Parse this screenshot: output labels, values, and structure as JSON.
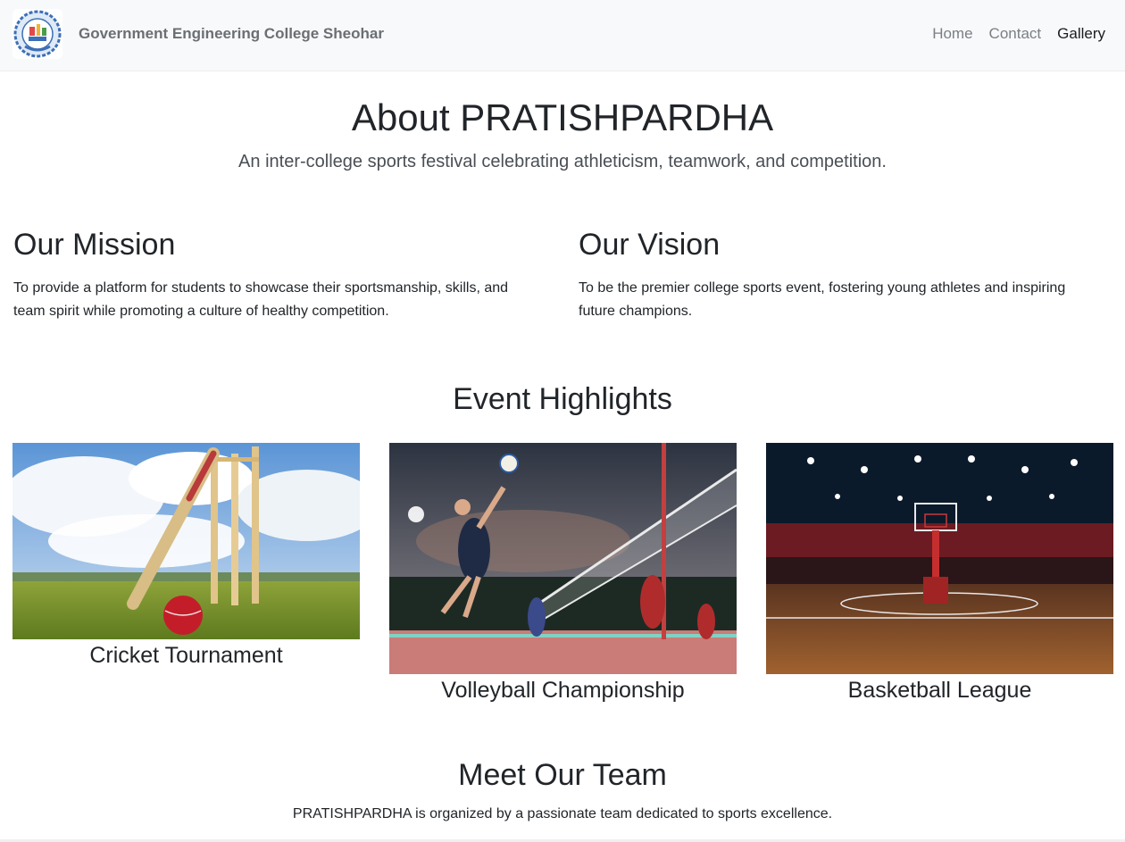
{
  "navbar": {
    "brand": "Government Engineering College Sheohar",
    "logo_icon": "college-emblem-icon",
    "links": [
      {
        "label": "Home",
        "active": false
      },
      {
        "label": "Contact",
        "active": false
      },
      {
        "label": "Gallery",
        "active": true
      }
    ]
  },
  "hero": {
    "title": "About PRATISHPARDHA",
    "subtitle": "An inter-college sports festival celebrating athleticism, teamwork, and competition."
  },
  "mission": {
    "heading": "Our Mission",
    "text": "To provide a platform for students to showcase their sportsmanship, skills, and team spirit while promoting a culture of healthy competition."
  },
  "vision": {
    "heading": "Our Vision",
    "text": "To be the premier college sports event, fostering young athletes and inspiring future champions."
  },
  "highlights": {
    "heading": "Event Highlights",
    "events": [
      {
        "title": "Cricket Tournament",
        "image": "cricket-bat-stumps-image"
      },
      {
        "title": "Volleyball Championship",
        "image": "volleyball-players-image"
      },
      {
        "title": "Basketball League",
        "image": "basketball-arena-image"
      }
    ]
  },
  "team": {
    "heading": "Meet Our Team",
    "text": "PRATISHPARDHA is organized by a passionate team dedicated to sports excellence."
  },
  "colors": {
    "navbar_bg": "#f8f9fa",
    "text": "#212529",
    "nav_link": "#7a7f85",
    "nav_active": "#1a1d20"
  }
}
